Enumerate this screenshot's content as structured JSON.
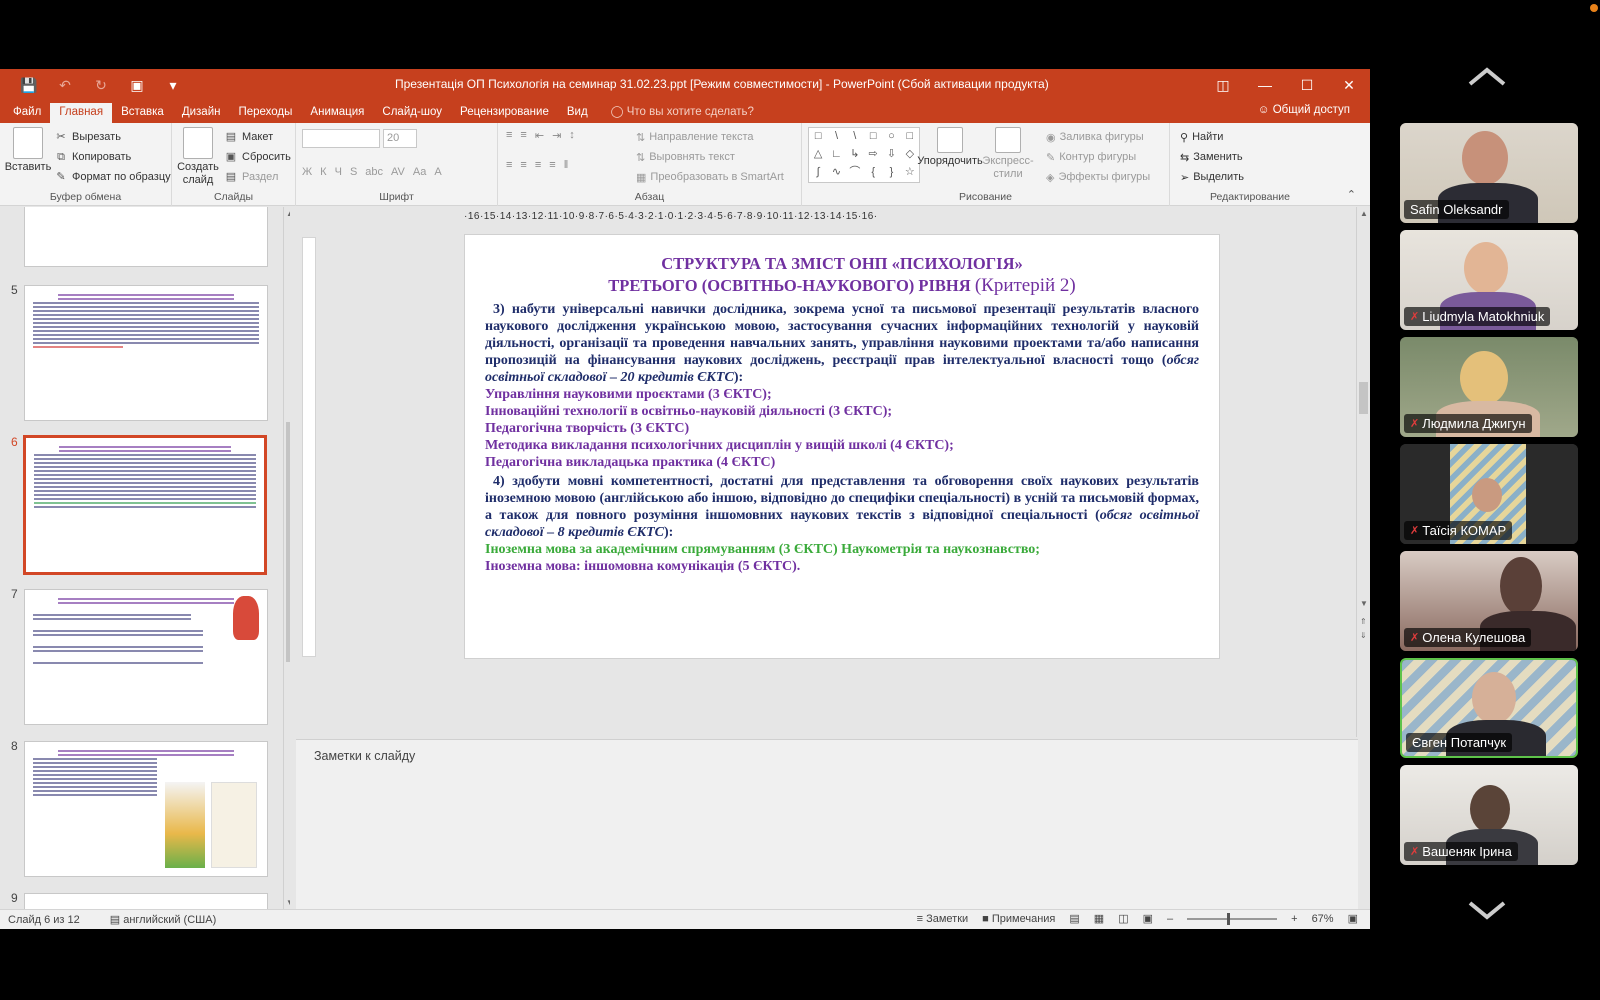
{
  "window": {
    "title": "Презентація ОП Психологія на семинар 31.02.23.ppt [Режим совместимости] - PowerPoint (Сбой активации продукта)"
  },
  "menu": {
    "tabs": [
      "Файл",
      "Главная",
      "Вставка",
      "Дизайн",
      "Переходы",
      "Анимация",
      "Слайд-шоу",
      "Рецензирование",
      "Вид"
    ],
    "active": "Главная",
    "tell_me": "Что вы хотите сделать?",
    "share": "Общий доступ"
  },
  "ribbon": {
    "clipboard": {
      "paste": "Вставить",
      "cut": "Вырезать",
      "copy": "Копировать",
      "format_painter": "Формат по образцу",
      "label": "Буфер обмена"
    },
    "slides": {
      "new_slide": "Создать слайд",
      "layout": "Макет",
      "reset": "Сбросить",
      "section": "Раздел",
      "label": "Слайды"
    },
    "font": {
      "size": "20",
      "label": "Шрифт"
    },
    "paragraph": {
      "text_direction": "Направление текста",
      "align_text": "Выровнять текст",
      "smartart": "Преобразовать в SmartArt",
      "label": "Абзац"
    },
    "drawing": {
      "arrange": "Упорядочить",
      "quick_styles": "Экспресс-стили",
      "fill": "Заливка фигуры",
      "outline": "Контур фигуры",
      "effects": "Эффекты фигуры",
      "label": "Рисование"
    },
    "editing": {
      "find": "Найти",
      "replace": "Заменить",
      "select": "Выделить",
      "label": "Редактирование"
    }
  },
  "thumbnails": {
    "numbers": [
      "5",
      "6",
      "7",
      "8",
      "9"
    ],
    "selected": "6"
  },
  "ruler": {
    "text": "·16·15·14·13·12·11·10·9·8·7·6·5·4·3·2·1·0·1·2·3·4·5·6·7·8·9·10·11·12·13·14·15·16·"
  },
  "slide": {
    "title_line1": "СТРУКТУРА ТА ЗМІСТ ОНП «ПСИХОЛОГІЯ»",
    "title_line2": "ТРЕТЬОГО (ОСВІТНЬО-НАУКОВОГО) РІВНЯ",
    "title_criterion": "(Критерій 2)",
    "p3_text": "3) набути універсальні навички дослідника, зокрема усної та письмової презентації результатів власного наукового дослідження українською мовою, застосування сучасних інформаційних технологій у науковій діяльності, організації та проведення навчальних занять, управління науковими проектами та/або написання пропозицій на фінансування наукових досліджень, реєстрації прав інтелектуальної власності тощо (",
    "p3_italic": "обсяг освітньої складової – 20 кредитів ЄКТС",
    "p3_end": "):",
    "courses_p3": [
      "Управління науковими проєктами (3 ЄКТС);",
      " Інноваційні технології в освітньо-науковій діяльності (3 ЄКТС);",
      " Педагогічна творчість (3 ЄКТС)",
      " Методика викладання психологічних дисциплін у вищій школі (4 ЄКТС);",
      " Педагогічна викладацька практика (4 ЄКТС)"
    ],
    "p4_text": "4) здобути мовні компетентності, достатні для представлення та обговорення своїх наукових результатів іноземною мовою (англійською або іншою, відповідно до специфіки спеціальності) в усній та письмовій формах, а також для повного розуміння іншомовних наукових текстів з відповідної спеціальності (",
    "p4_italic": "обсяг освітньої складової – 8 кредитів ЄКТС",
    "p4_end": "):",
    "green_line": "Іноземна мова за академічним спрямуванням (3 ЄКТС) Наукометрія та наукознавство;",
    "last_line": "Іноземна мова: іншомовна комунікація (5 ЄКТС)."
  },
  "notes": {
    "placeholder": "Заметки к слайду"
  },
  "status": {
    "slide_count": "Слайд 6 из 12",
    "language": "английский (США)",
    "notes_btn": "Заметки",
    "comments_btn": "Примечания",
    "zoom": "67%"
  },
  "participants": [
    {
      "name": "Safin Oleksandr",
      "muted": false,
      "active": false
    },
    {
      "name": "Liudmyla Matokhniuk",
      "muted": true,
      "active": false
    },
    {
      "name": "Людмила Джигун",
      "muted": true,
      "active": false
    },
    {
      "name": "Таїсія КОМАР",
      "muted": true,
      "active": false
    },
    {
      "name": "Олена Кулешова",
      "muted": true,
      "active": false
    },
    {
      "name": "Євген Потапчук",
      "muted": false,
      "active": true
    },
    {
      "name": "Вашеняк Ірина",
      "muted": true,
      "active": false
    }
  ]
}
